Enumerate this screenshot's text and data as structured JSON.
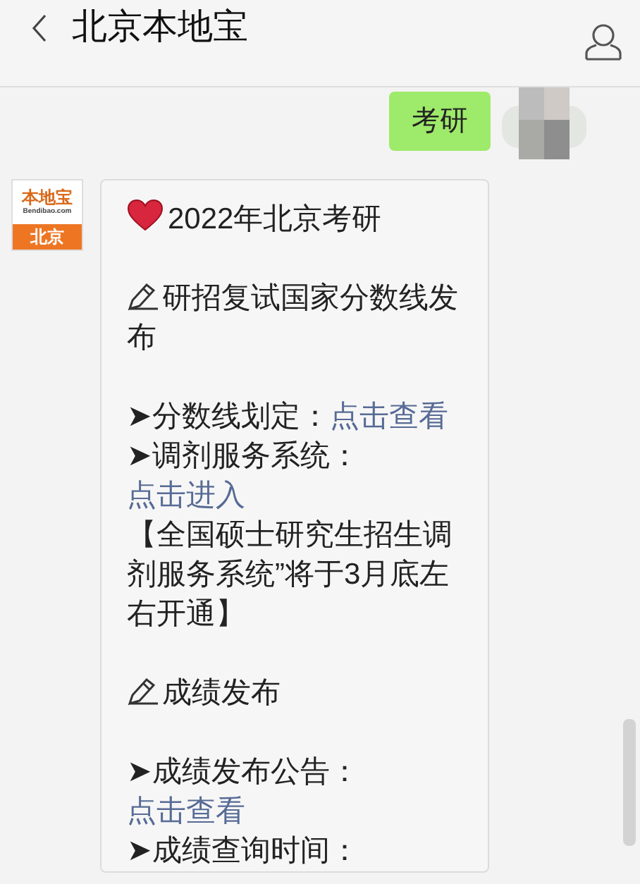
{
  "header": {
    "title": "北京本地宝"
  },
  "messages": [
    {
      "kind": "outgoing",
      "text": "考研"
    },
    {
      "kind": "incoming",
      "logo": {
        "brand": "本地宝",
        "site": "Bendibao.com",
        "city": "北京"
      },
      "blocks": [
        {
          "kind": "title",
          "text": "2022年北京考研"
        },
        {
          "kind": "section",
          "text": "研招复试国家分数线发布"
        },
        {
          "kind": "link-line",
          "label": "➤分数线划定：",
          "link": "点击查看"
        },
        {
          "kind": "link-line",
          "label": "➤调剂服务系统：",
          "link": "点击进入"
        },
        {
          "kind": "note",
          "text": "【全国硕士研究生招生调剂服务系统”将于3月底左右开通】"
        },
        {
          "kind": "section",
          "text": "成绩发布"
        },
        {
          "kind": "link-line",
          "label": "➤成绩发布公告：",
          "link": "点击查看"
        },
        {
          "kind": "note",
          "text": "➤成绩查询时间："
        }
      ]
    }
  ]
}
